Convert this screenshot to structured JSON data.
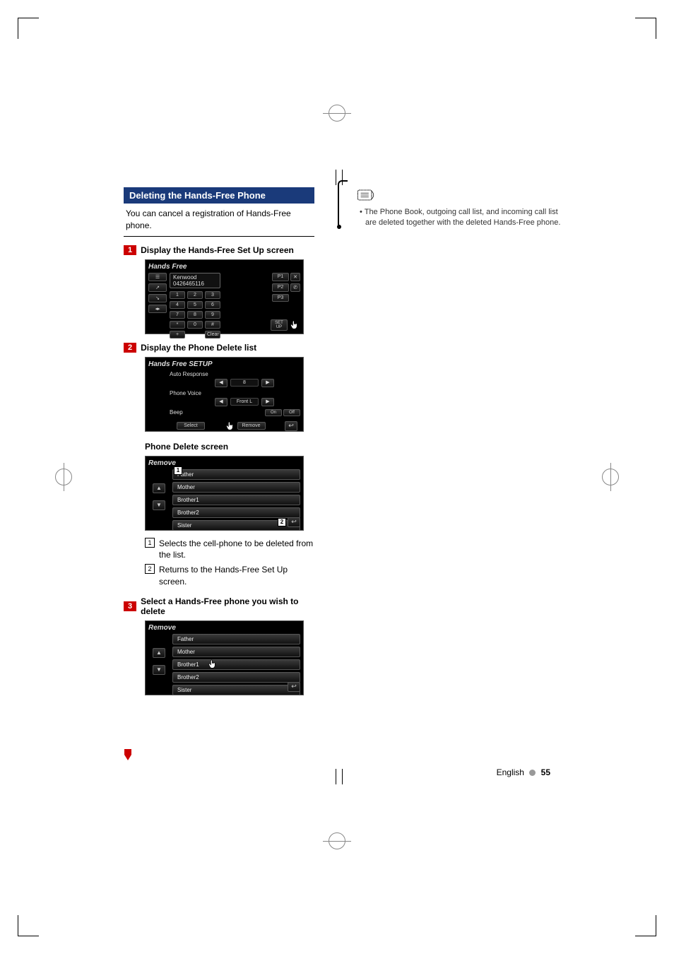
{
  "section_title": "Deleting the Hands-Free Phone",
  "intro": "You can cancel a registration of Hands-Free phone.",
  "steps": {
    "s1": {
      "num": "1",
      "title": "Display the Hands-Free Set Up screen"
    },
    "s2": {
      "num": "2",
      "title": "Display the Phone Delete list"
    },
    "s3": {
      "num": "3",
      "title": "Select a Hands-Free phone you wish to delete"
    }
  },
  "phone_delete_heading": "Phone Delete screen",
  "callout_desc": {
    "c1": "Selects the cell-phone to be deleted from the list.",
    "c2": "Returns to the Hands-Free Set Up screen."
  },
  "note": "The Phone Book, outgoing call list, and incoming call list are deleted together with the deleted Hands-Free phone.",
  "footer": {
    "lang": "English",
    "page": "55"
  },
  "hf_screen": {
    "title": "Hands Free",
    "name": "Kenwood",
    "number": "0426465116",
    "keypad": [
      "1",
      "2",
      "3",
      "4",
      "5",
      "6",
      "7",
      "8",
      "9",
      "*",
      "0",
      "#"
    ],
    "plus": "+",
    "clear": "Clear",
    "presets": [
      "P1",
      "P2",
      "P3"
    ],
    "left_icons": [
      "phonebook-icon",
      "outgoing-icon",
      "incoming-icon",
      "voice-icon"
    ]
  },
  "setup_screen": {
    "title": "Hands Free SETUP",
    "rows": {
      "auto_response": {
        "label": "Auto Response",
        "value": "8"
      },
      "phone_voice": {
        "label": "Phone Voice",
        "value": "Front L"
      },
      "beep": {
        "label": "Beep",
        "on": "On",
        "off": "Off"
      }
    },
    "select": "Select",
    "remove": "Remove"
  },
  "remove_screen": {
    "title": "Remove",
    "items": [
      "Father",
      "Mother",
      "Brother1",
      "Brother2",
      "Sister"
    ]
  }
}
